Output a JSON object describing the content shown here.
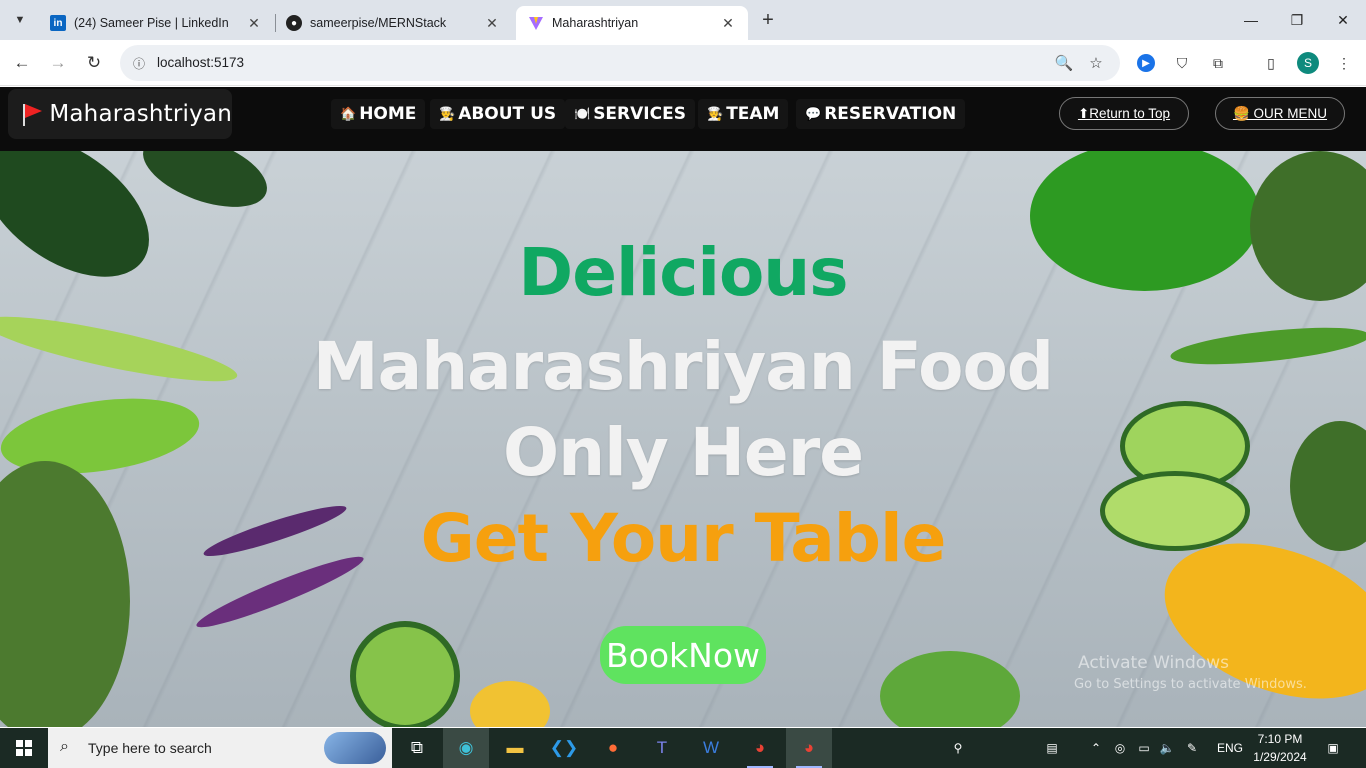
{
  "browser": {
    "tabs": [
      {
        "title": "(24) Sameer Pise | LinkedIn",
        "icon": "linkedin-icon"
      },
      {
        "title": "sameerpise/MERNStack",
        "icon": "github-icon"
      },
      {
        "title": "Maharashtriyan",
        "icon": "vite-icon"
      }
    ],
    "url": "localhost:5173"
  },
  "site": {
    "brand": "Maharashtriyan",
    "nav": [
      {
        "label": "HOME",
        "icon": "🏠"
      },
      {
        "label": "ABOUT US",
        "icon": "👨‍🍳"
      },
      {
        "label": "SERVICES",
        "icon": "🍽️"
      },
      {
        "label": "TEAM",
        "icon": "🧑‍🍳"
      },
      {
        "label": "RESERVATION",
        "icon": "💬"
      }
    ],
    "return_top": "⬆Return to Top",
    "our_menu": "🍔 OUR MENU"
  },
  "hero": {
    "line1": "Delicious",
    "line2": "Maharashriyan Food Only Here",
    "line3": "Get Your Table",
    "cta": "BookNow"
  },
  "watermark": {
    "line1": "Activate Windows",
    "line2": "Go to Settings to activate Windows."
  },
  "taskbar": {
    "search_placeholder": "Type here to search",
    "lang": "ENG",
    "time": "7:10 PM",
    "date": "1/29/2024"
  },
  "colors": {
    "green": "#10a862",
    "orange": "#f6a00e",
    "cta": "#5fe35f"
  }
}
